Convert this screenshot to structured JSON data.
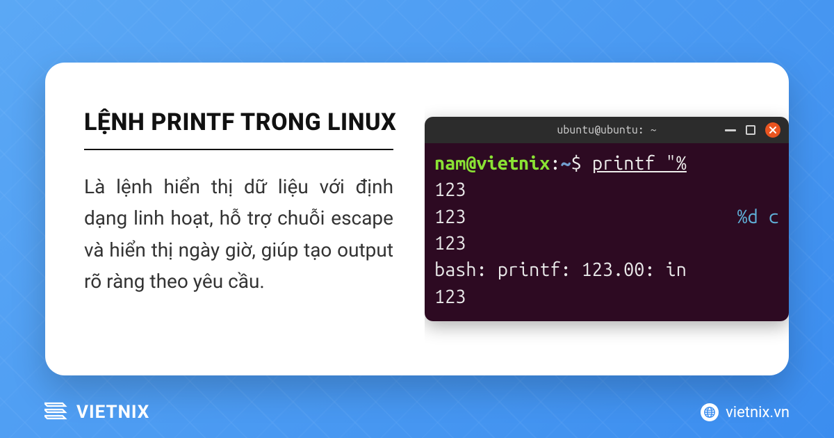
{
  "card": {
    "title": "LỆNH PRINTF TRONG LINUX",
    "description": "Là lệnh hiển thị dữ liệu với định dạng linh hoạt, hỗ trợ chuỗi escape và hiển thị ngày giờ, giúp tạo output rõ ràng theo yêu cầu."
  },
  "terminal": {
    "window_title": "ubuntu@ubuntu: ~",
    "prompt_user": "nam@vietnix",
    "prompt_sep": ":",
    "prompt_path": "~",
    "prompt_dollar": "$ ",
    "command": "printf \"%",
    "lines": {
      "l1": "123",
      "l2": "123",
      "l2_hint": "%d c",
      "l3": "123",
      "l4": "bash: printf: 123.00: in",
      "l5": "123"
    }
  },
  "footer": {
    "brand": "VIETNIX",
    "site": "vietnix.vn"
  }
}
